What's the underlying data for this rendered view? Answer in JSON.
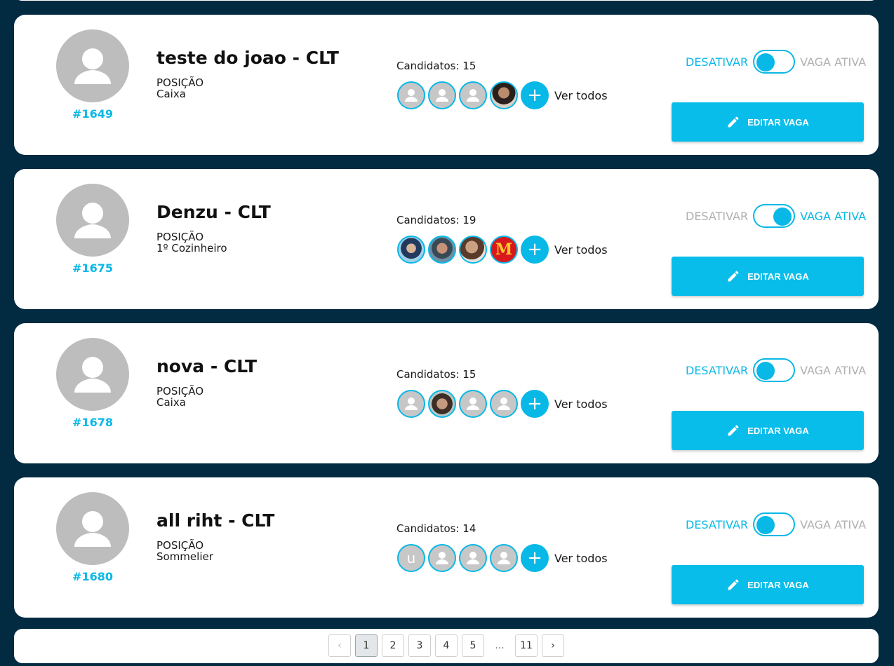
{
  "jobs": [
    {
      "id": "#1649",
      "title": "teste do joao - CLT",
      "position_label": "POSIÇÃO",
      "position": "Caixa",
      "candidates": "Candidatos: 15",
      "status": "inactive"
    },
    {
      "id": "#1675",
      "title": "Denzu - CLT",
      "position_label": "POSIÇÃO",
      "position": "1º Cozinheiro",
      "candidates": "Candidatos: 19",
      "status": "active"
    },
    {
      "id": "#1678",
      "title": "nova - CLT",
      "position_label": "POSIÇÃO",
      "position": "Caixa",
      "candidates": "Candidatos: 15",
      "status": "inactive"
    },
    {
      "id": "#1680",
      "title": "all riht - CLT",
      "position_label": "POSIÇÃO",
      "position": "Sommelier",
      "candidates": "Candidatos: 14",
      "status": "inactive",
      "first_candidate_initial": "u"
    }
  ],
  "labels": {
    "see_all": "Ver todos",
    "deactivate": "DESATIVAR",
    "active_job": "VAGA ATIVA",
    "edit_job": "EDITAR VAGA",
    "plus": "+",
    "mcd_logo": "M"
  },
  "pagination": {
    "pages": [
      "1",
      "2",
      "3",
      "4",
      "5"
    ],
    "ellipsis": "...",
    "last": "11",
    "current": "1",
    "prev": "‹",
    "next": "›"
  },
  "colors": {
    "accent": "#08b8e6",
    "background": "#022a41",
    "inactive_text": "#b0b0b0"
  },
  "icons": [
    "person-icon",
    "plus-icon",
    "pencil-icon",
    "chevron-left-icon",
    "chevron-right-icon"
  ]
}
